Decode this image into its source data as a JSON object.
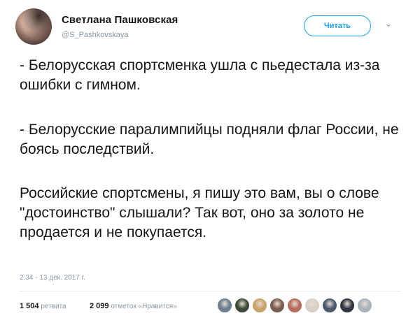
{
  "tweet": {
    "author": {
      "display_name": "Светлана Пашковская",
      "handle": "@S_Pashkovskaya"
    },
    "follow_label": "Читать",
    "paragraphs": [
      "- Белорусская спортсменка ушла с пьедестала из-за ошибки с гимном.",
      "- Белорусские паралимпийцы подняли флаг России, не боясь последствий.",
      "Российские спортсмены, я пишу это вам, вы о слове \"достоинство\" слышали? Так вот, оно за золото не продается и не покупается."
    ],
    "timestamp": "2:34 - 13 дек. 2017 г.",
    "stats": {
      "retweets_count": "1 504",
      "retweets_label": "ретвита",
      "likes_count": "2 099",
      "likes_label": "отметок «Нравится»"
    },
    "liker_avatar_colors": [
      "#6b7f8e",
      "#3c4a3a",
      "#c9a36a",
      "#7a5c50",
      "#b56c5a",
      "#d9d0c8",
      "#4a5a6e",
      "#2e3440",
      "#a9b3bd"
    ]
  }
}
